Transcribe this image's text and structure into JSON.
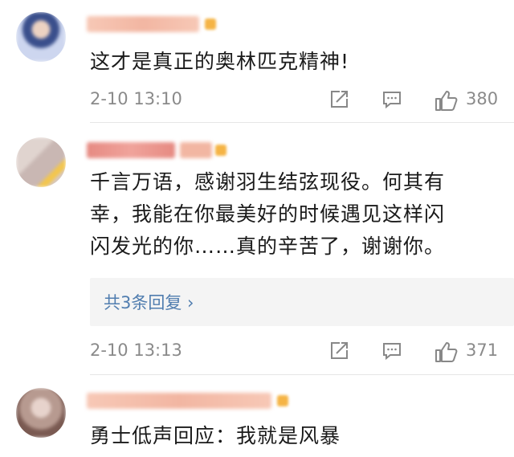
{
  "comments": [
    {
      "text": "这才是真正的奥林匹克精神!",
      "time": "2-10 13:10",
      "likes": "380",
      "colors": {
        "avatar": [
          "#3a4f8c",
          "#cdd6ef",
          "#ecd2c2"
        ],
        "username": "#f2b6a2"
      }
    },
    {
      "text_lines": [
        "千言万语，感谢羽生结弦现役。何其有",
        "幸，我能在你最美好的时候遇见这样闪",
        "闪发光的你……真的辛苦了，谢谢你。"
      ],
      "replies_label": "共3条回复 ›",
      "time": "2-10 13:13",
      "likes": "371",
      "colors": {
        "avatar": [
          "#c9b7b3",
          "#e0d4cf",
          "#f3c64d"
        ],
        "username": "#e68a82"
      }
    },
    {
      "text": "勇士低声回应：我就是风暴",
      "colors": {
        "avatar": [
          "#7a5a52",
          "#b79a90",
          "#e7d3cc"
        ],
        "username": "#f2b6a2"
      }
    }
  ],
  "icons": {
    "share": "share-icon",
    "comment": "comment-icon",
    "like": "thumbs-up-icon"
  },
  "accent": {
    "link": "#507daf",
    "text": "#1a1a1a",
    "meta": "#8a8a8a"
  }
}
